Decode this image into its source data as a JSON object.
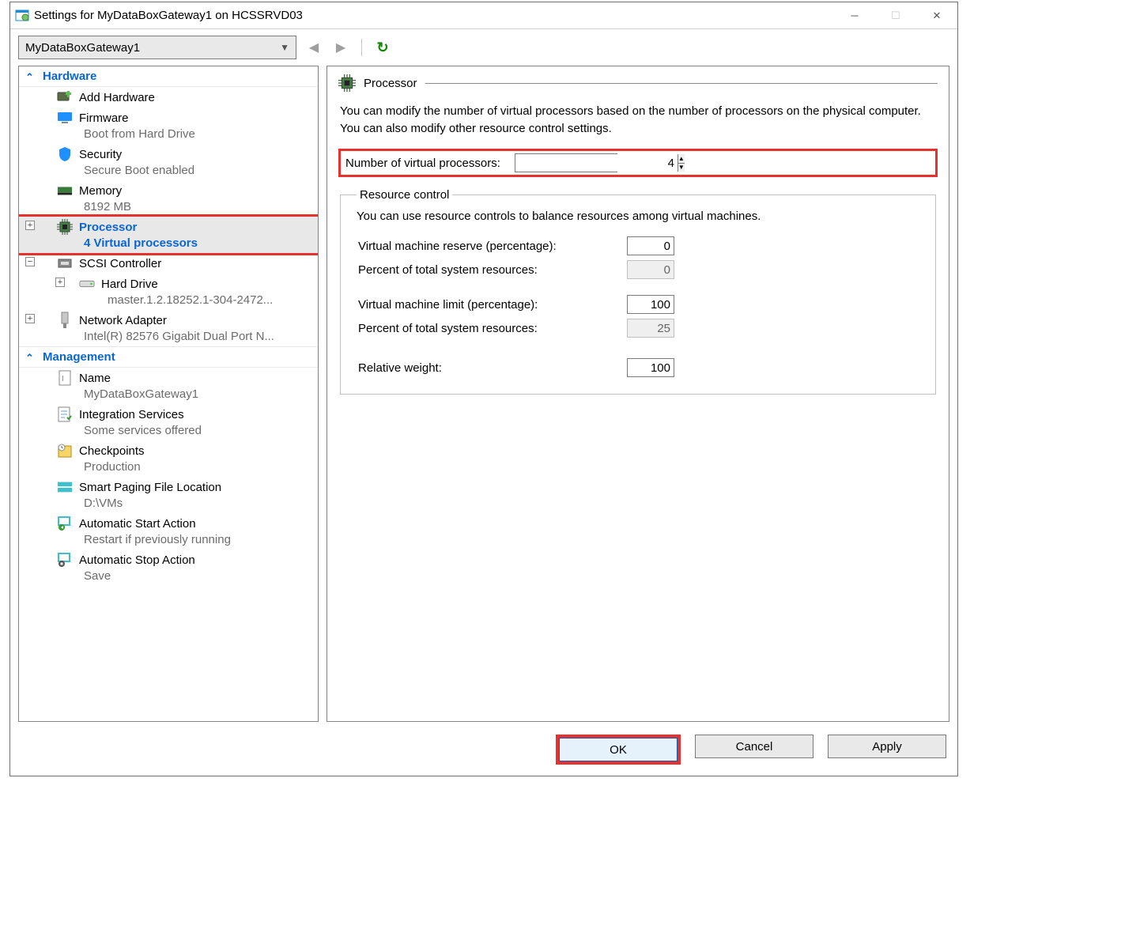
{
  "window": {
    "title": "Settings for MyDataBoxGateway1 on HCSSRVD03"
  },
  "toolbar": {
    "combo": "MyDataBoxGateway1"
  },
  "sections": {
    "hardware": "Hardware",
    "management": "Management"
  },
  "tree": {
    "addHardware": "Add Hardware",
    "firmware": {
      "label": "Firmware",
      "sub": "Boot from Hard Drive"
    },
    "security": {
      "label": "Security",
      "sub": "Secure Boot enabled"
    },
    "memory": {
      "label": "Memory",
      "sub": "8192 MB"
    },
    "processor": {
      "label": "Processor",
      "sub": "4 Virtual processors"
    },
    "scsi": {
      "label": "SCSI Controller"
    },
    "hardDrive": {
      "label": "Hard Drive",
      "sub": "master.1.2.18252.1-304-2472..."
    },
    "nic": {
      "label": "Network Adapter",
      "sub": "Intel(R) 82576 Gigabit Dual Port N..."
    },
    "name": {
      "label": "Name",
      "sub": "MyDataBoxGateway1"
    },
    "integ": {
      "label": "Integration Services",
      "sub": "Some services offered"
    },
    "chk": {
      "label": "Checkpoints",
      "sub": "Production"
    },
    "paging": {
      "label": "Smart Paging File Location",
      "sub": "D:\\VMs"
    },
    "astart": {
      "label": "Automatic Start Action",
      "sub": "Restart if previously running"
    },
    "astop": {
      "label": "Automatic Stop Action",
      "sub": "Save"
    }
  },
  "panel": {
    "heading": "Processor",
    "desc": "You can modify the number of virtual processors based on the number of processors on the physical computer. You can also modify other resource control settings.",
    "numLabel": "Number of virtual processors:",
    "numValue": "4",
    "group": {
      "legend": "Resource control",
      "desc": "You can use resource controls to balance resources among virtual machines.",
      "reserveLabel": "Virtual machine reserve (percentage):",
      "reserveValue": "0",
      "reservePctLabel": "Percent of total system resources:",
      "reservePctValue": "0",
      "limitLabel": "Virtual machine limit (percentage):",
      "limitValue": "100",
      "limitPctLabel": "Percent of total system resources:",
      "limitPctValue": "25",
      "weightLabel": "Relative weight:",
      "weightValue": "100"
    }
  },
  "buttons": {
    "ok": "OK",
    "cancel": "Cancel",
    "apply": "Apply"
  }
}
